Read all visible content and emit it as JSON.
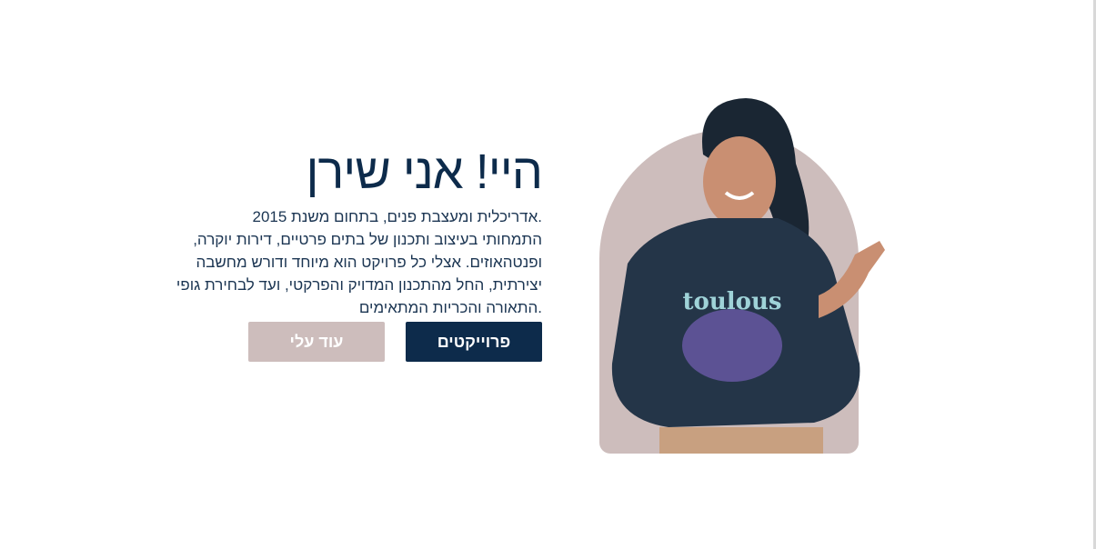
{
  "hero": {
    "title": "היי! אני שירן",
    "paragraph_lines": [
      "אדריכלית ומעצבת פנים, בתחום משנת 2015.",
      "התמחותי בעיצוב ותכנון של בתים פרטיים, דירות יוקרה,",
      "ופנטהאוזים. אצלי כל פרויקט הוא מיוחד ודורש מחשבה",
      "יצירתית, החל מהתכנון המדויק והפרקטי, ועד לבחירת גופי",
      "התאורה והכריות המתאימים."
    ],
    "projects_label": "פרוייקטים",
    "about_label": "עוד עלי"
  },
  "colors": {
    "navy": "#0d2b4b",
    "blush": "#cdbdbc"
  }
}
